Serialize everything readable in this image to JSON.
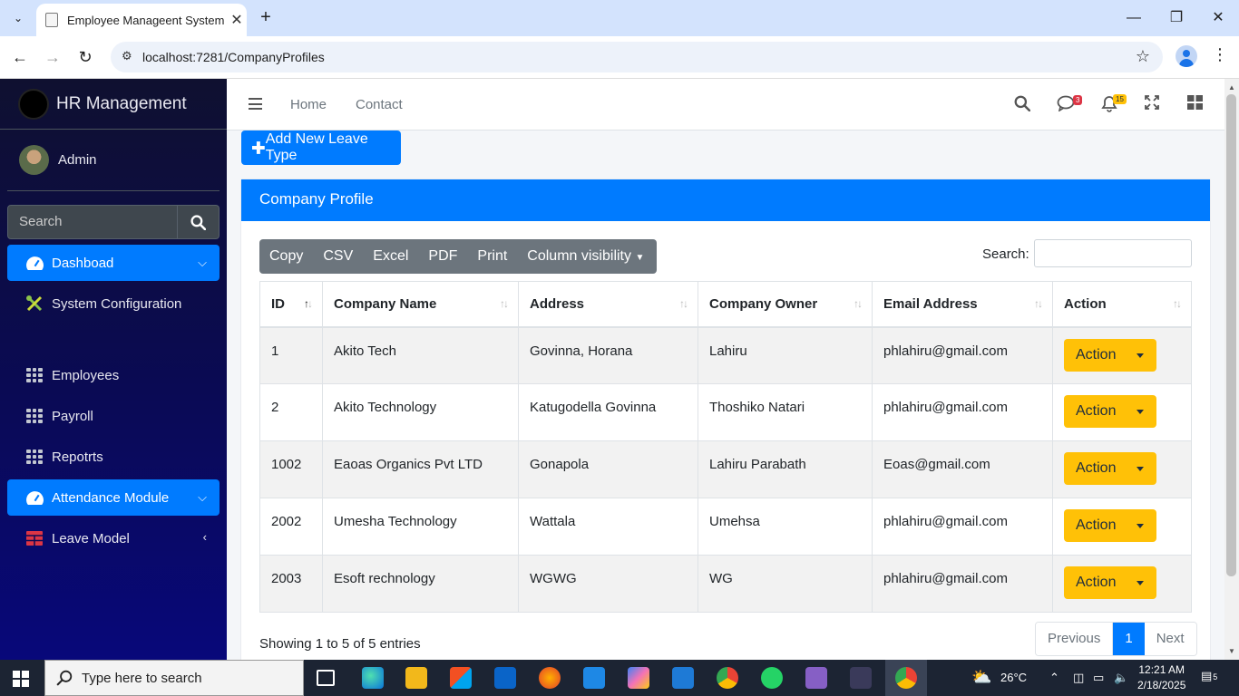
{
  "browser": {
    "tab_title": "Employee Manageent System",
    "url": "localhost:7281/CompanyProfiles"
  },
  "sidebar": {
    "brand": "HR Management",
    "user": "Admin",
    "search_placeholder": "Search",
    "items": [
      {
        "label": "Dashboad",
        "active": true
      },
      {
        "label": "System Configuration"
      },
      {
        "label": "Employees"
      },
      {
        "label": "Payroll"
      },
      {
        "label": "Repotrts"
      },
      {
        "label": "Attendance Module",
        "active": true
      },
      {
        "label": "Leave Model"
      }
    ]
  },
  "topnav": {
    "home": "Home",
    "contact": "Contact",
    "messages_count": "3",
    "notifications_count": "15"
  },
  "main": {
    "add_button": "Add New Leave Type",
    "card_title": "Company Profile",
    "export_buttons": [
      "Copy",
      "CSV",
      "Excel",
      "PDF",
      "Print",
      "Column visibility"
    ],
    "search_label": "Search:",
    "columns": [
      "ID",
      "Company Name",
      "Address",
      "Company Owner",
      "Email Address",
      "Action"
    ],
    "rows": [
      {
        "id": "1",
        "name": "Akito Tech",
        "address": "Govinna, Horana",
        "owner": "Lahiru",
        "email": "phlahiru@gmail.com",
        "action": "Action"
      },
      {
        "id": "2",
        "name": "Akito Technology",
        "address": "Katugodella Govinna",
        "owner": "Thoshiko Natari",
        "email": "phlahiru@gmail.com",
        "action": "Action"
      },
      {
        "id": "1002",
        "name": "Eaoas Organics Pvt LTD",
        "address": "Gonapola",
        "owner": "Lahiru Parabath",
        "email": "Eoas@gmail.com",
        "action": "Action"
      },
      {
        "id": "2002",
        "name": "Umesha Technology",
        "address": "Wattala",
        "owner": "Umehsa",
        "email": "phlahiru@gmail.com",
        "action": "Action"
      },
      {
        "id": "2003",
        "name": "Esoft rechnology",
        "address": "WGWG",
        "owner": "WG",
        "email": "phlahiru@gmail.com",
        "action": "Action"
      }
    ],
    "info": "Showing 1 to 5 of 5 entries",
    "pager": {
      "previous": "Previous",
      "current": "1",
      "next": "Next"
    }
  },
  "taskbar": {
    "search_placeholder": "Type here to search",
    "weather": "26°C",
    "time": "12:21 AM",
    "date": "2/18/2025",
    "notification_count": "5"
  },
  "colors": {
    "primary": "#007bff",
    "warning": "#ffc107",
    "sidebar": "#0a0a55"
  }
}
